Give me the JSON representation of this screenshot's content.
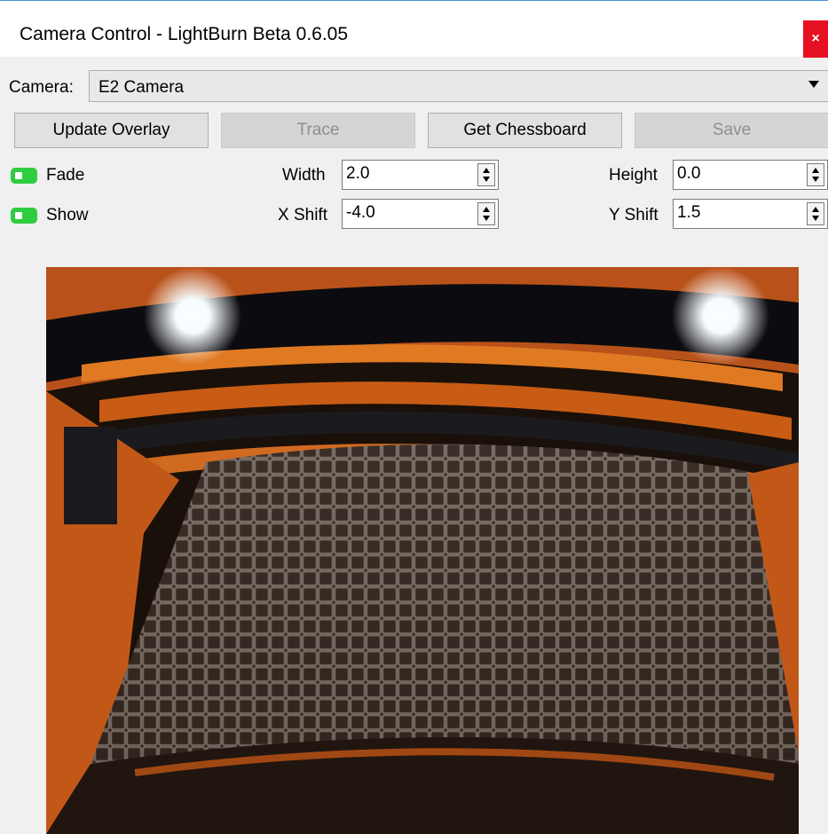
{
  "window": {
    "title": "Camera Control - LightBurn Beta 0.6.05",
    "close_label": "×"
  },
  "camera": {
    "label": "Camera:",
    "selected": "E2 Camera"
  },
  "buttons": {
    "update_overlay": "Update Overlay",
    "trace": "Trace",
    "get_chessboard": "Get Chessboard",
    "save": "Save"
  },
  "toggles": {
    "fade": {
      "label": "Fade",
      "on": true
    },
    "show": {
      "label": "Show",
      "on": true
    }
  },
  "fields": {
    "width": {
      "label": "Width",
      "value": "2.0"
    },
    "height": {
      "label": "Height",
      "value": "0.0"
    },
    "x_shift": {
      "label": "X Shift",
      "value": "-4.0"
    },
    "y_shift": {
      "label": "Y Shift",
      "value": "1.5"
    }
  },
  "colors": {
    "accent_toggle": "#2ecc40",
    "close": "#e81123",
    "laser_body": "#d8601a"
  },
  "preview": {
    "icon": "camera-feed-image"
  }
}
